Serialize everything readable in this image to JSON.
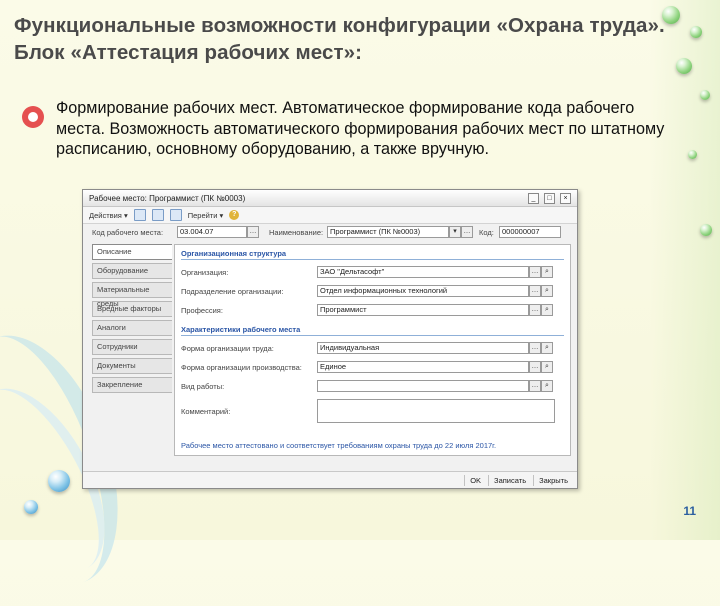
{
  "slide": {
    "title": "Функциональные возможности конфигурации «Охрана труда». Блок «Аттестация рабочих мест»:",
    "bullet_text": "Формирование рабочих мест. Автоматическое формирование кода рабочего места. Возможность автоматического формирования рабочих мест по штатному расписанию, основному оборудованию, а также вручную.",
    "page_number": "11"
  },
  "window": {
    "title": "Рабочее место: Программист (ПК №0003)",
    "toolbar": {
      "actions": "Действия ▾",
      "goto": "Перейти ▾"
    },
    "header_fields": {
      "code_label": "Код рабочего места:",
      "code_value": "03.004.07",
      "name_label": "Наименование:",
      "name_value": "Программист (ПК №0003)",
      "num_label": "Код:",
      "num_value": "000000007"
    },
    "tabs": [
      "Описание",
      "Оборудование",
      "Материальные среды",
      "Вредные факторы",
      "Аналоги",
      "Сотрудники",
      "Документы",
      "Закрепление"
    ],
    "section1": "Организационная структура",
    "org_label": "Организация:",
    "org_value": "ЗАО \"Дельтасофт\"",
    "dept_label": "Подразделение организации:",
    "dept_value": "Отдел информационных технологий",
    "prof_label": "Профессия:",
    "prof_value": "Программист",
    "section2": "Характеристики рабочего места",
    "form_label": "Форма организации труда:",
    "form_value": "Индивидуальная",
    "prod_label": "Форма организации производства:",
    "prod_value": "Единое",
    "work_label": "Вид работы:",
    "work_value": "",
    "comment_label": "Комментарий:",
    "comment_value": "",
    "note": "Рабочее место аттестовано и соответствует требованиям охраны труда до 22 июля 2017г.",
    "buttons": {
      "ok": "OK",
      "save": "Записать",
      "close": "Закрыть"
    }
  },
  "colors": {
    "title": "#4a4a4a",
    "bullet": "#e55050",
    "page_number": "#2c5fa0",
    "section": "#2b56a6"
  }
}
